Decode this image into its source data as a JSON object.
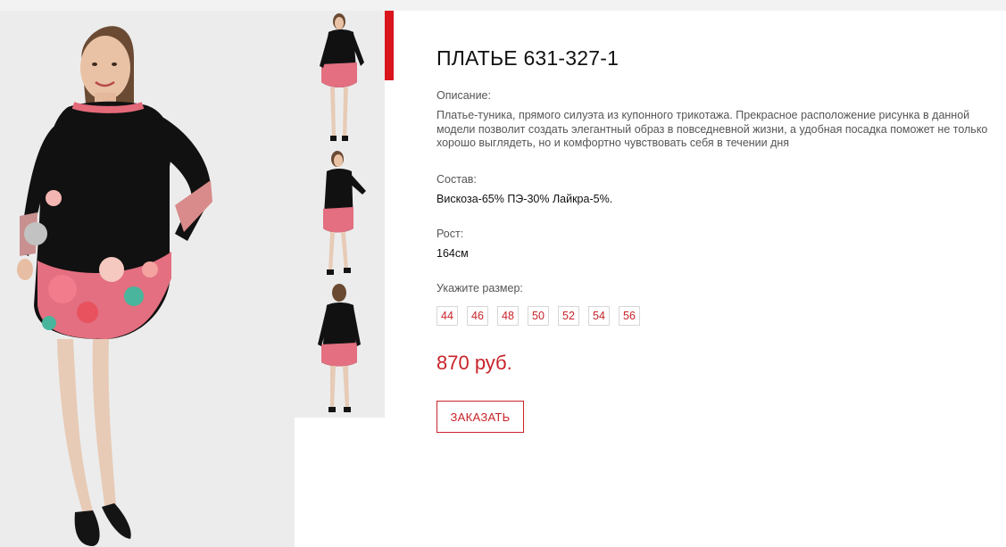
{
  "product": {
    "title": "ПЛАТЬЕ 631-327-1",
    "description_label": "Описание:",
    "description": "Платье-туника, прямого силуэта из купонного трикотажа. Прекрасное расположение рисунка в данной модели позволит создать элегантный образ в повседневной жизни, а удобная посадка поможет не только хорошо выглядеть, но и комфортно чувствовать себя в течении дня",
    "composition_label": "Состав:",
    "composition": "Вискоза-65% ПЭ-30% Лайкра-5%.",
    "height_label": "Рост:",
    "height": "164см",
    "size_label": "Укажите размер:",
    "sizes": [
      "44",
      "46",
      "48",
      "50",
      "52",
      "54",
      "56"
    ],
    "price": "870 руб.",
    "order_button": "ЗАКАЗАТЬ"
  },
  "gallery": {
    "thumbnail_count": 3,
    "active_thumbnail": 1
  },
  "colors": {
    "accent": "#c8232a",
    "active_marker": "#d9141b",
    "dress": "#111111",
    "photo_background": "#ececec"
  }
}
